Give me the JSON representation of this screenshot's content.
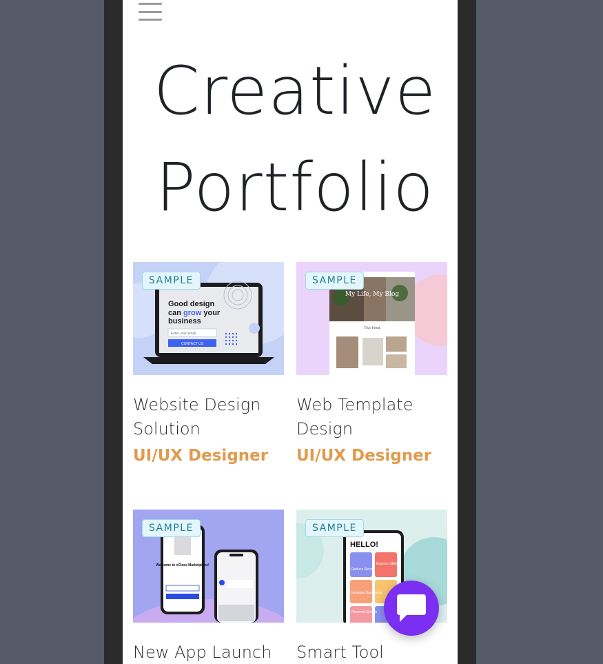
{
  "hero": {
    "title": "Creative Portfolio"
  },
  "cards": [
    {
      "badge": "SAMPLE",
      "title": "Website Design Solution",
      "role": "UI/UX Designer",
      "mockup": {
        "headline_1": "Good design",
        "headline_2a": "can ",
        "headline_2b": "grow",
        "headline_2c": " your",
        "headline_3": "business",
        "input_placeholder": "Enter your email",
        "button": "CONTACT US"
      }
    },
    {
      "badge": "SAMPLE",
      "title": "Web Template Design",
      "role": "UI/UX Designer",
      "mockup": {
        "headline": "My Life, My Blog",
        "subhead": "The Feed"
      }
    },
    {
      "badge": "SAMPLE",
      "title": "New App Launch",
      "role": "",
      "mockup": {
        "welcome": "Welcome to eClass Marketplace!"
      }
    },
    {
      "badge": "SAMPLE",
      "title": "Smart Tool",
      "role": "",
      "mockup": {
        "greeting": "HELLO!",
        "tiles": [
          "Reduce Stress",
          "Improve Skills",
          "Increase Happiness",
          "Personal Growth"
        ]
      }
    }
  ],
  "colors": {
    "accent": "#e19a4d",
    "chat": "#7b2ff0",
    "badge_text": "#1e7f98"
  },
  "icons": {
    "menu": "hamburger-icon",
    "chat": "chat-bubble-icon"
  }
}
